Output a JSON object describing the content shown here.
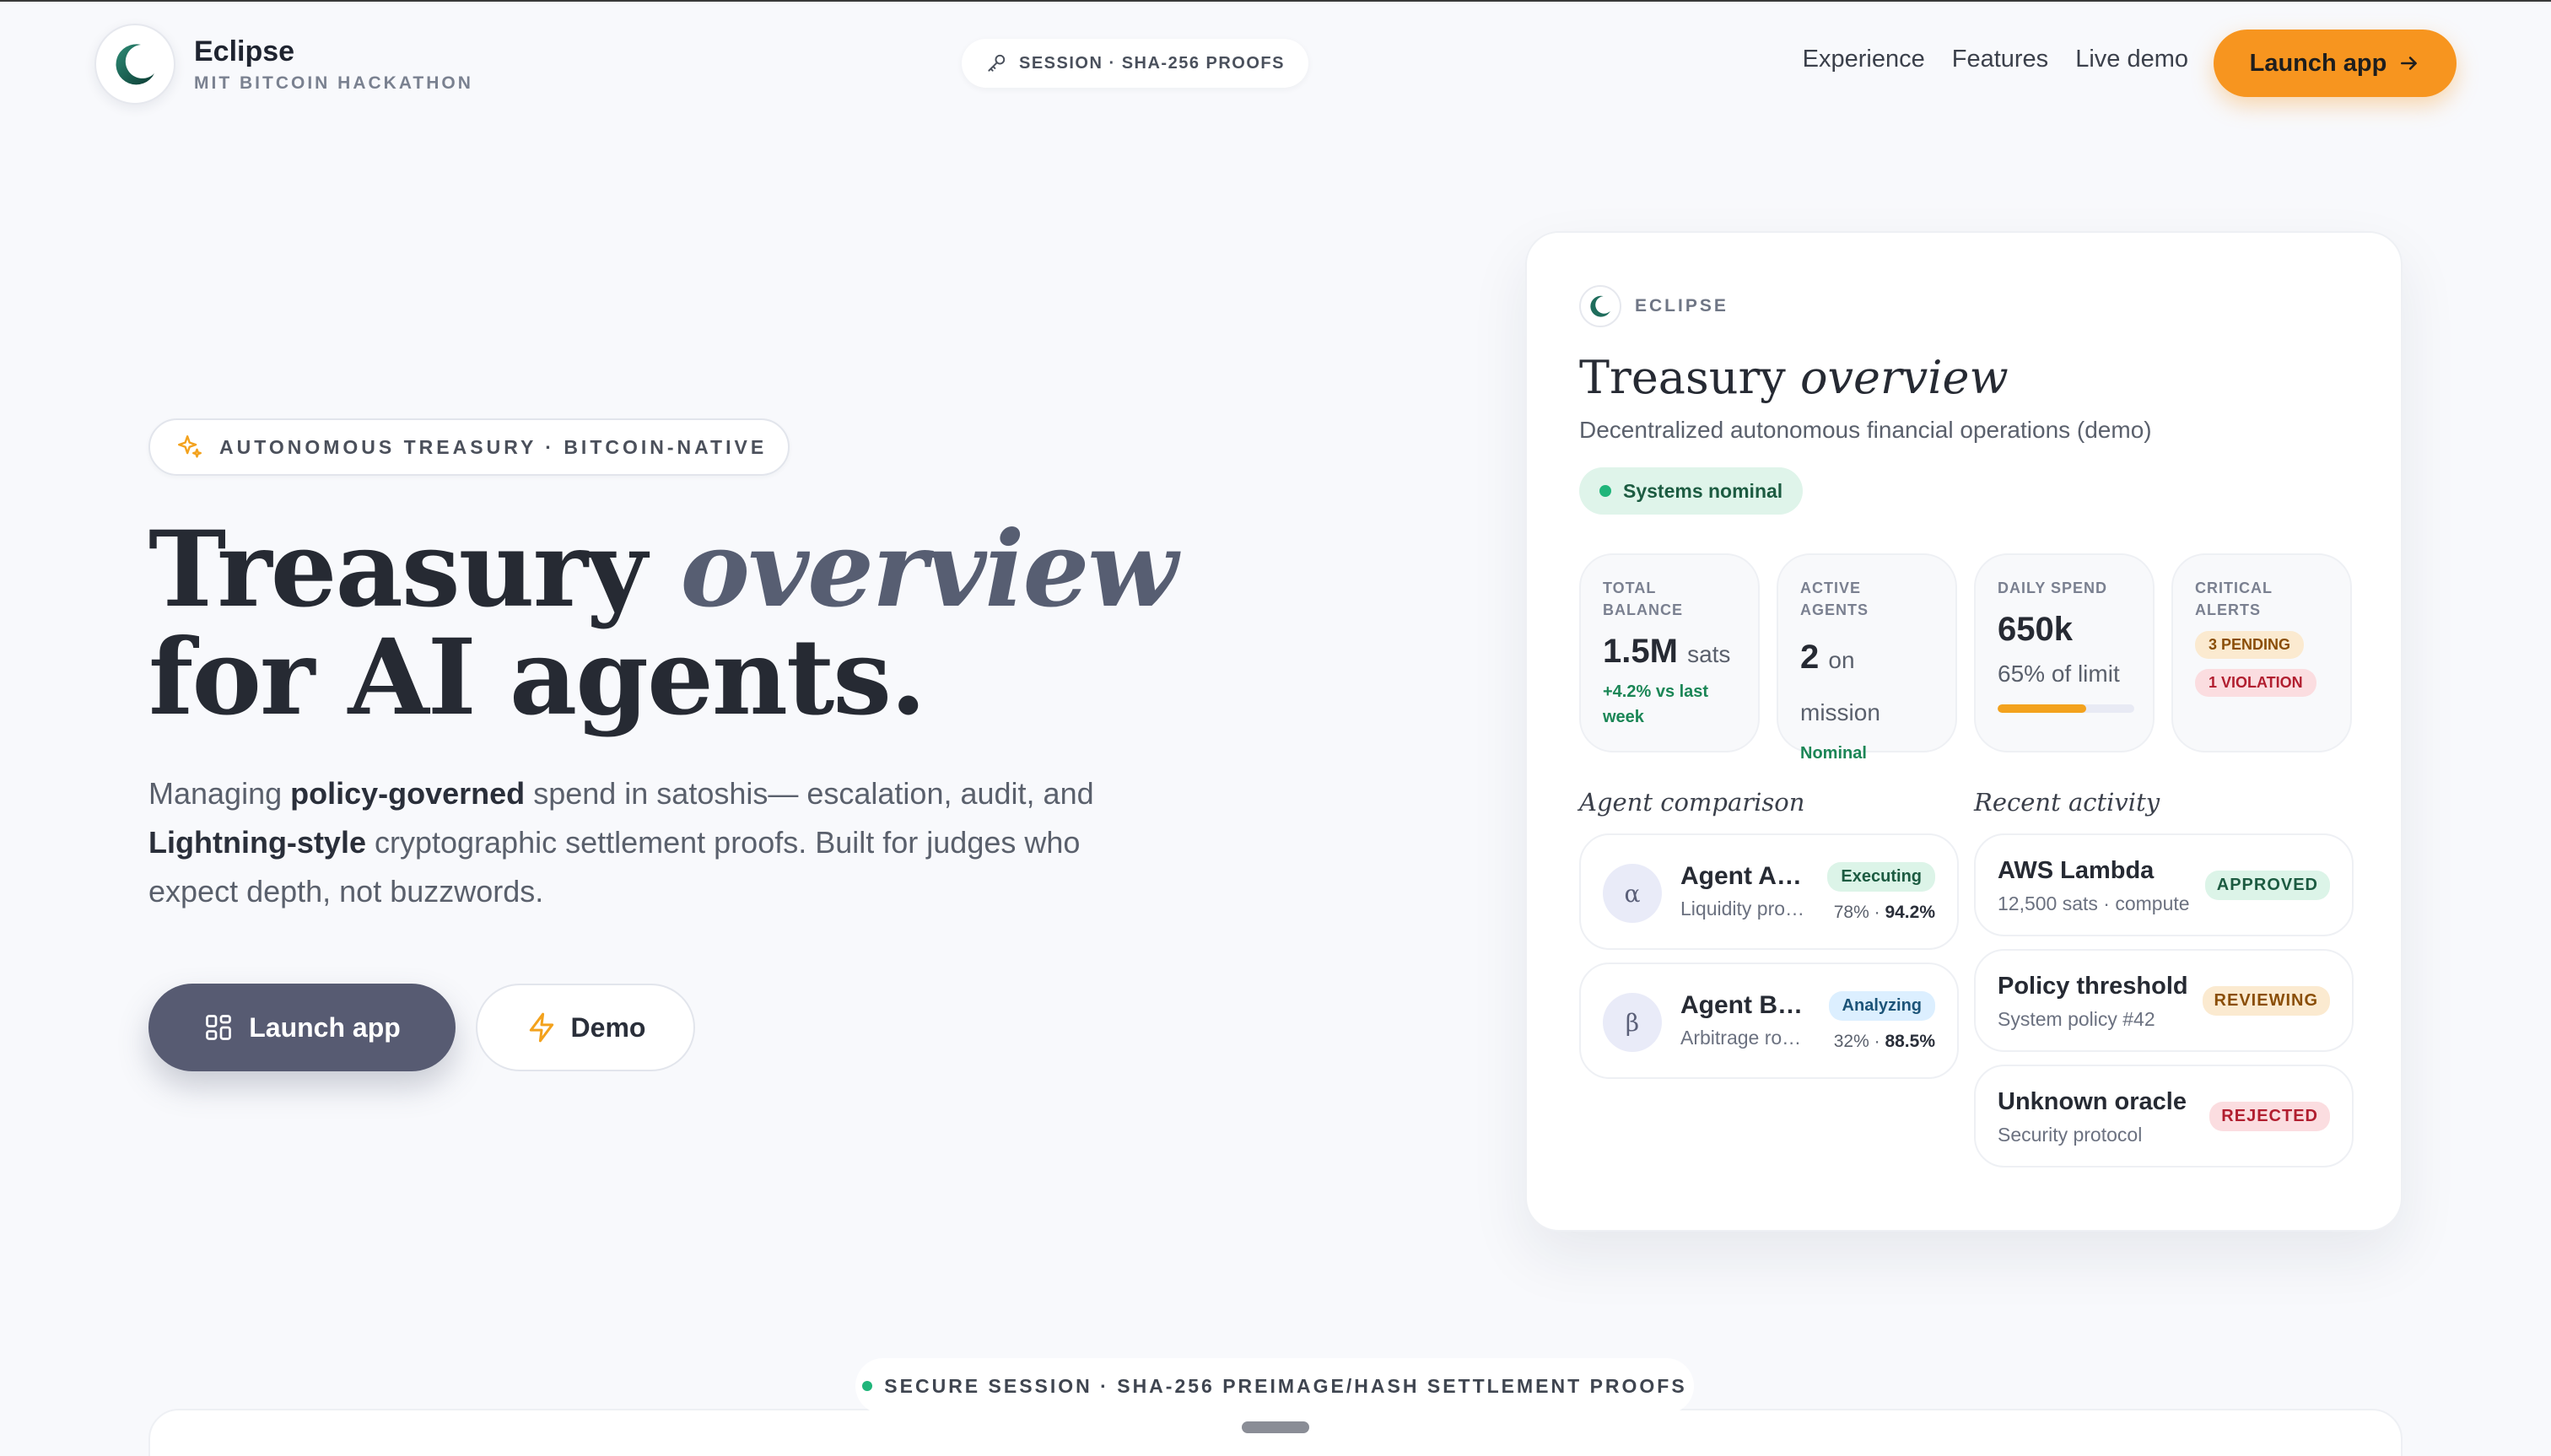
{
  "nav": {
    "brand_name": "Eclipse",
    "brand_sub": "MIT BITCOIN HACKATHON",
    "session_label": "SESSION · SHA-256 PROOFS",
    "links": [
      "Experience",
      "Features",
      "Live demo"
    ],
    "cta_label": "Launch app"
  },
  "hero": {
    "badge": "AUTONOMOUS TREASURY · BITCOIN-NATIVE",
    "title_word": "Treasury",
    "title_italic": "overview",
    "title_line2": "for AI agents.",
    "lead_1": "Managing ",
    "lead_bold_1": "policy-governed",
    "lead_2": " spend in satoshis— escalation, audit, and ",
    "lead_bold_2": "Lightning-style",
    "lead_3": " cryptographic settlement proofs. Built for judges who expect depth, not buzzwords.",
    "primary_label": "Launch app",
    "secondary_label": "Demo"
  },
  "card": {
    "brand": "ECLIPSE",
    "title_word": "Treasury",
    "title_italic": "overview",
    "subtitle": "Decentralized autonomous financial operations (demo)",
    "status": "Systems nominal",
    "metrics": {
      "balance": {
        "label": "TOTAL BALANCE",
        "value": "1.5M",
        "unit": "sats",
        "note": "+4.2% vs last week"
      },
      "agents": {
        "label": "ACTIVE AGENTS",
        "value": "2",
        "unit": "on mission",
        "note": "Nominal"
      },
      "spend": {
        "label": "DAILY SPEND",
        "value": "650k",
        "note": "65% of limit",
        "progress": 0.65
      },
      "alerts": {
        "label": "CRITICAL ALERTS",
        "pending": "3 PENDING",
        "violation": "1 VIOLATION"
      }
    },
    "agent_section": "Agent comparison",
    "agents": [
      {
        "symbol": "α",
        "name": "Agent Alpha",
        "desc": "Liquidity provider",
        "status": "Executing",
        "pct": "78%",
        "score": "94.2%"
      },
      {
        "symbol": "β",
        "name": "Agent Beta",
        "desc": "Arbitrage router",
        "status": "Analyzing",
        "pct": "32%",
        "score": "88.5%"
      }
    ],
    "activity_section": "Recent activity",
    "activity": [
      {
        "title": "AWS Lambda",
        "sub": "12,500 sats · compute",
        "status": "APPROVED"
      },
      {
        "title": "Policy threshold",
        "sub": "System policy #42",
        "status": "REVIEWING"
      },
      {
        "title": "Unknown oracle",
        "sub": "Security protocol",
        "status": "REJECTED"
      }
    ]
  },
  "footer": {
    "secure_label": "SECURE SESSION · SHA-256 PREIMAGE/HASH SETTLEMENT PROOFS"
  }
}
